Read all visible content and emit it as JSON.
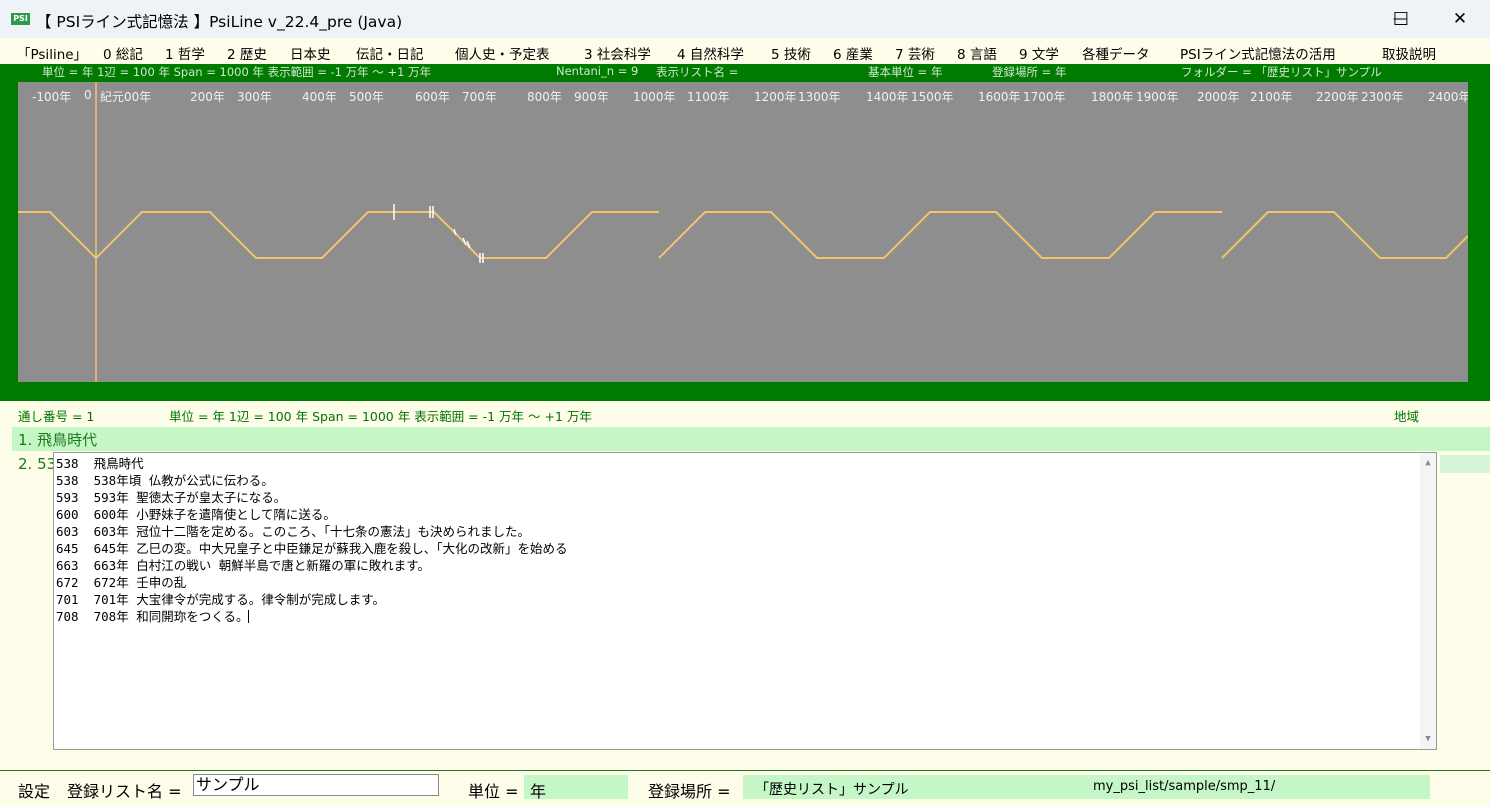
{
  "window": {
    "title": "【 PSIライン式記憶法 】PsiLine v_22.4_pre (Java)",
    "logo_text": "PSI",
    "minimize_icon": "—",
    "maximize_icon": "☐",
    "close_icon": "✕"
  },
  "menu": [
    "「Psiline」",
    "0 総記",
    "1 哲学",
    "2 歴史",
    "日本史",
    "伝記・日記",
    "個人史・予定表",
    "3 社会科学",
    "4 自然科学",
    "5 技術",
    "6 産業",
    "7 芸術",
    "8 言語",
    "9 文学",
    "各種データ",
    "PSIライン式記憶法の活用",
    "取扱説明"
  ],
  "timeline": {
    "info": [
      "単位 = 年  1辺 = 100 年  Span = 1000 年  表示範囲 = -1 万年 〜 +1 万年",
      "Nentani_n = 9",
      "表示リスト名 =",
      "基本単位 = 年",
      "登録場所 = 年",
      "フォルダー = 「歴史リスト」サンプル"
    ],
    "ticks": [
      "-100年",
      "0",
      "紀元00年",
      "200年",
      "300年",
      "400年",
      "500年",
      "600年",
      "700年",
      "800年",
      "900年",
      "1000年",
      "1100年",
      "1200年",
      "1300年",
      "1400年",
      "1500年",
      "1600年",
      "1700年",
      "1800年",
      "1900年",
      "2000年",
      "2100年",
      "2200年",
      "2300年",
      "2400年"
    ],
    "line_color": "#f2c46e"
  },
  "status": {
    "serial": "通し番号 = 1",
    "unit_info": "単位 = 年  1辺 = 100 年  Span = 1000 年  表示範囲 = -1 万年 〜 +1 万年",
    "region": "地域"
  },
  "list": {
    "row1": "1. 飛鳥時代",
    "row2_prefix": "2. 53"
  },
  "editor": {
    "lines": [
      "538  飛鳥時代",
      "538  538年頃 仏教が公式に伝わる。",
      "593  593年 聖徳太子が皇太子になる。",
      "600  600年 小野妹子を遣隋使として隋に送る。",
      "603  603年 冠位十二階を定める。このころ、「十七条の憲法」も決められました。",
      "645  645年 乙巳の変。中大兄皇子と中臣鎌足が蘇我入鹿を殺し、「大化の改新」を始める",
      "663  663年 白村江の戦い 朝鮮半島で唐と新羅の軍に敗れます。",
      "672  672年 壬申の乱",
      "701  701年 大宝律令が完成する。律令制が完成します。",
      "708  708年 和同開珎をつくる。"
    ]
  },
  "bottom": {
    "settings": "設定",
    "list_name_label": "登録リスト名 =",
    "list_name_value": "サンプル",
    "unit_label": "単位 =",
    "unit_value": "年",
    "place_label": "登録場所 =",
    "place_value": "「歴史リスト」サンプル",
    "path": "my_psi_list/sample/smp_11/"
  }
}
